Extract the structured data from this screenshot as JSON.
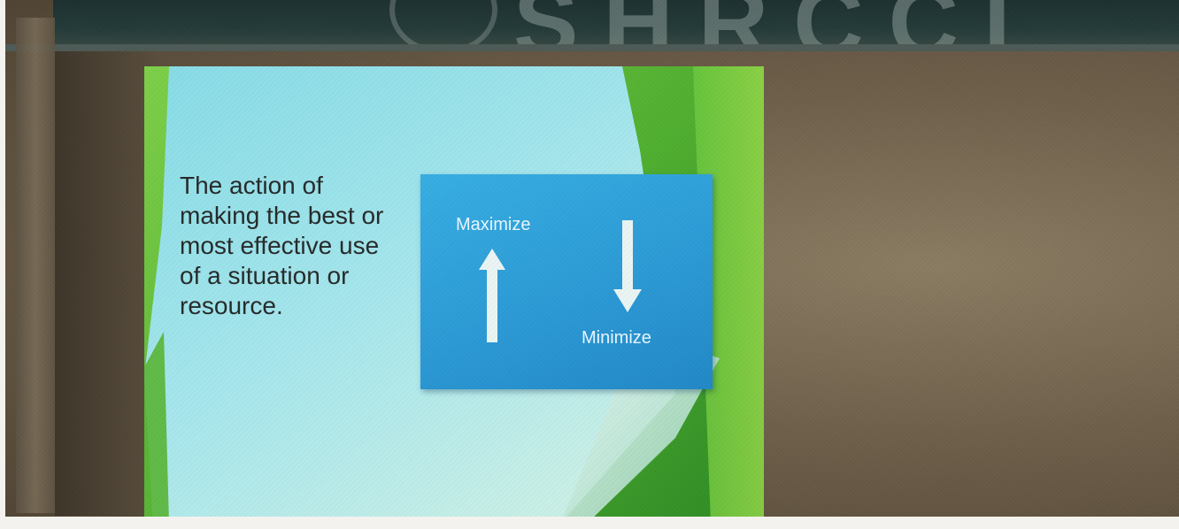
{
  "slide": {
    "body_lines": [
      "The action of",
      "making the best or",
      "most effective use",
      "of a situation or",
      "resource."
    ],
    "diagram": {
      "maximize_label": "Maximize",
      "minimize_label": "Minimize",
      "up_arrow_icon": "arrow-up-icon",
      "down_arrow_icon": "arrow-down-icon"
    }
  },
  "colors": {
    "slide_green": "#4fae2f",
    "slide_cyan": "#8fe0ea",
    "diagram_blue": "#2a98d4",
    "wall_brown": "#7a6b54"
  }
}
